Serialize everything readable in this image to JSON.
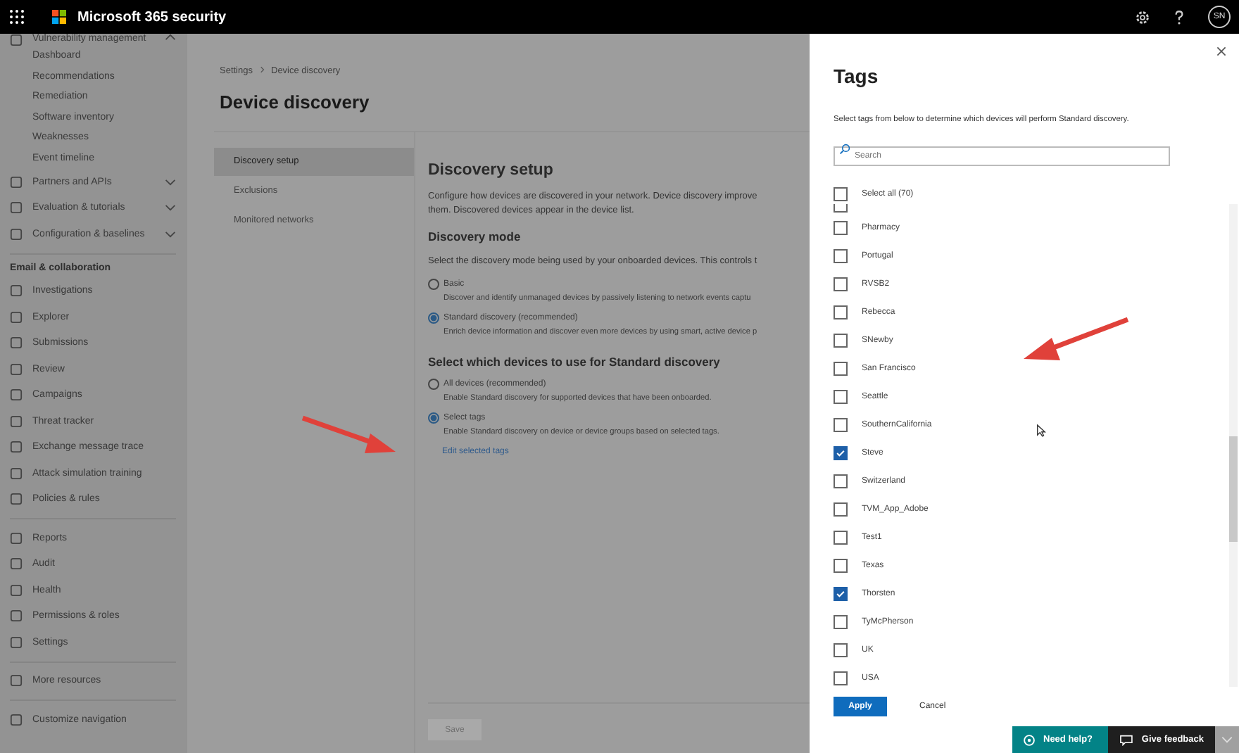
{
  "top_bar": {
    "app_title": "Microsoft 365 security",
    "avatar": "SN"
  },
  "nav": {
    "groups": [
      {
        "items": [
          {
            "label": "Vulnerability management",
            "expanded": true,
            "children": [
              {
                "label": "Dashboard"
              },
              {
                "label": "Recommendations"
              },
              {
                "label": "Remediation"
              },
              {
                "label": "Software inventory"
              },
              {
                "label": "Weaknesses"
              },
              {
                "label": "Event timeline"
              }
            ]
          },
          {
            "label": "Partners and APIs",
            "expanded": false
          },
          {
            "label": "Evaluation & tutorials",
            "expanded": false
          },
          {
            "label": "Configuration & baselines",
            "expanded": false
          }
        ]
      },
      {
        "header": "Email & collaboration",
        "items": [
          {
            "label": "Investigations"
          },
          {
            "label": "Explorer"
          },
          {
            "label": "Submissions"
          },
          {
            "label": "Review"
          },
          {
            "label": "Campaigns"
          },
          {
            "label": "Threat tracker"
          },
          {
            "label": "Exchange message trace"
          },
          {
            "label": "Attack simulation training"
          },
          {
            "label": "Policies & rules"
          }
        ]
      },
      {
        "items": [
          {
            "label": "Reports"
          },
          {
            "label": "Audit"
          },
          {
            "label": "Health"
          },
          {
            "label": "Permissions & roles"
          },
          {
            "label": "Settings"
          }
        ]
      },
      {
        "items": [
          {
            "label": "More resources"
          }
        ]
      },
      {
        "items": [
          {
            "label": "Customize navigation"
          }
        ]
      }
    ]
  },
  "breadcrumb": [
    "Settings",
    "Device discovery"
  ],
  "page_title": "Device discovery",
  "subnav": [
    {
      "label": "Discovery setup",
      "selected": true
    },
    {
      "label": "Exclusions",
      "selected": false
    },
    {
      "label": "Monitored networks",
      "selected": false
    }
  ],
  "setup": {
    "title": "Discovery setup",
    "description_lines": [
      "Configure how devices are discovered in your network. Device discovery improve",
      "them. Discovered devices appear in the device list."
    ]
  },
  "discovery_mode": {
    "title": "Discovery mode",
    "description": "Select the discovery mode being used by your onboarded devices. This controls t",
    "options": [
      {
        "label": "Basic",
        "description": "Discover and identify unmanaged devices by passively listening to network events captu",
        "selected": false
      },
      {
        "label": "Standard discovery (recommended)",
        "description": "Enrich device information and discover even more devices by using smart, active device p",
        "selected": true
      }
    ]
  },
  "device_scope": {
    "title": "Select which devices to use for Standard discovery",
    "options": [
      {
        "label": "All devices (recommended)",
        "description": "Enable Standard discovery for supported devices that have been onboarded.",
        "selected": false
      },
      {
        "label": "Select tags",
        "description": "Enable Standard discovery on device or device groups based on selected tags.",
        "selected": true
      }
    ],
    "edit_link": "Edit selected tags"
  },
  "save_button": "Save",
  "tags_panel": {
    "title": "Tags",
    "description": "Select tags from below to determine which devices will perform Standard discovery.",
    "search": {
      "placeholder": "Search"
    },
    "select_all": {
      "label": "Select all (70)",
      "checked": false
    },
    "tags": [
      {
        "label": "Pharmacy",
        "checked": false
      },
      {
        "label": "Portugal",
        "checked": false
      },
      {
        "label": "RVSB2",
        "checked": false
      },
      {
        "label": "Rebecca",
        "checked": false
      },
      {
        "label": "SNewby",
        "checked": false
      },
      {
        "label": "San Francisco",
        "checked": false
      },
      {
        "label": "Seattle",
        "checked": false
      },
      {
        "label": "SouthernCalifornia",
        "checked": false
      },
      {
        "label": "Steve",
        "checked": true
      },
      {
        "label": "Switzerland",
        "checked": false
      },
      {
        "label": "TVM_App_Adobe",
        "checked": false
      },
      {
        "label": "Test1",
        "checked": false
      },
      {
        "label": "Texas",
        "checked": false
      },
      {
        "label": "Thorsten",
        "checked": true
      },
      {
        "label": "TyMcPherson",
        "checked": false
      },
      {
        "label": "UK",
        "checked": false
      },
      {
        "label": "USA",
        "checked": false
      }
    ],
    "apply_button": "Apply",
    "cancel_button": "Cancel"
  },
  "help_bar": {
    "need_help": "Need help?",
    "give_feedback": "Give feedback"
  }
}
